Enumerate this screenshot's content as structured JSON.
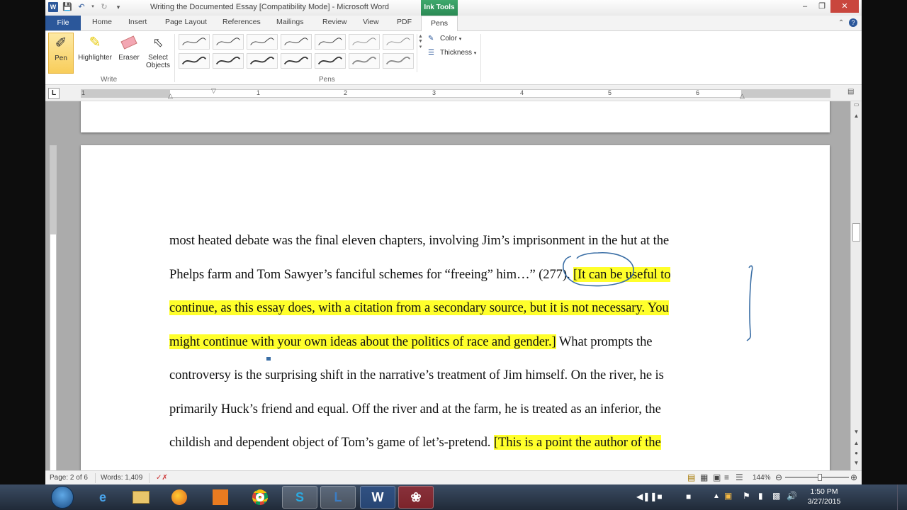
{
  "titlebar": {
    "title": "Writing the Documented Essay [Compatibility Mode]  -  Microsoft Word",
    "ink_tools": "Ink Tools"
  },
  "tabs": [
    "File",
    "Home",
    "Insert",
    "Page Layout",
    "References",
    "Mailings",
    "Review",
    "View",
    "PDF",
    "Pens"
  ],
  "ribbon": {
    "pen": "Pen",
    "highlighter": "Highlighter",
    "eraser": "Eraser",
    "select_line1": "Select",
    "select_line2": "Objects",
    "write_group": "Write",
    "pens_group": "Pens",
    "color": "Color",
    "thickness": "Thickness"
  },
  "ruler": {
    "numbers": [
      "1",
      "1",
      "2",
      "3",
      "4",
      "5",
      "6"
    ]
  },
  "document": {
    "lines": [
      {
        "parts": [
          {
            "text": "most heated debate was the final eleven chapters, involving Jim’s imprisonment in the hut at the",
            "hl": false
          }
        ]
      },
      {
        "parts": [
          {
            "text": "Phelps farm and Tom Sawyer’s fanciful schemes for “freeing” him…” (277).  ",
            "hl": false
          },
          {
            "text": "[It can be useful to",
            "hl": true
          }
        ]
      },
      {
        "parts": [
          {
            "text": "continue, as this essay does, with a citation from a secondary source, but it is not necessary.  You",
            "hl": true
          }
        ]
      },
      {
        "parts": [
          {
            "text": "might continue with your own ideas about the politics of race and gender.]",
            "hl": true
          },
          {
            "text": "  What prompts the",
            "hl": false
          }
        ]
      },
      {
        "parts": [
          {
            "text": "controversy is the surprising shift in the narrative’s treatment of Jim himself.  On the river, he is",
            "hl": false
          }
        ]
      },
      {
        "parts": [
          {
            "text": "primarily Huck’s friend and equal.  Off the river and at the farm, he is treated as an inferior, the",
            "hl": false
          }
        ]
      },
      {
        "parts": [
          {
            "text": "childish and dependent object of Tom’s game of let’s-pretend.  ",
            "hl": false
          },
          {
            "text": "[This is a point the author of the",
            "hl": true
          }
        ]
      }
    ],
    "highlight_color": "#ffff2b",
    "ink_color": "#3a6ea5"
  },
  "statusbar": {
    "page": "Page: 2 of 6",
    "words": "Words: 1,409",
    "zoom": "144%"
  },
  "taskbar": {
    "apps": [
      "internet-explorer",
      "file-explorer",
      "firefox",
      "office",
      "chrome",
      "skype",
      "lync",
      "word",
      "acrobat"
    ],
    "time": "1:50 PM",
    "date": "3/27/2015"
  }
}
